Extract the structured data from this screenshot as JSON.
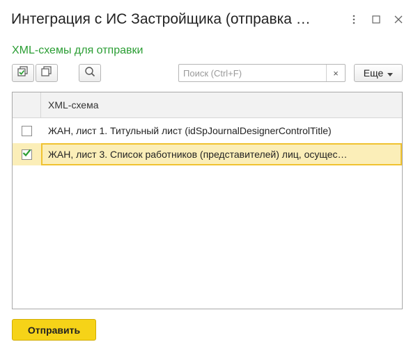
{
  "window": {
    "title": "Интеграция с ИС Застройщика (отправка …",
    "controls": [
      "more-vertical-icon",
      "maximize-icon",
      "close-icon"
    ]
  },
  "form": {
    "subtitle": "XML-схемы для отправки",
    "subtitle_color": "#2a9d33"
  },
  "toolbar": {
    "check_all_icon": "check-all-icon",
    "uncheck_all_icon": "uncheck-all-icon",
    "search_icon": "search-icon",
    "search_placeholder": "Поиск (Ctrl+F)",
    "search_value": "",
    "clear_label": "×",
    "more_label": "Еще"
  },
  "table": {
    "column_header": "XML-схема",
    "rows": [
      {
        "checked": false,
        "text": "ЖАН, лист 1. Титульный лист (idSpJournalDesignerControlTitle)"
      },
      {
        "checked": true,
        "selected": true,
        "text": "ЖАН, лист 3. Список работников (представителей) лиц, осущес…"
      }
    ]
  },
  "footer": {
    "send_label": "Отправить",
    "send_color": "#f6d318"
  }
}
